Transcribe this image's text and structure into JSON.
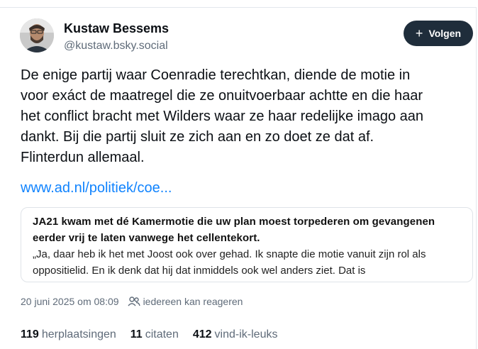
{
  "author": {
    "display_name": "Kustaw Bessems",
    "handle": "@kustaw.bsky.social"
  },
  "follow_button": {
    "label": "Volgen",
    "icon": "plus-icon"
  },
  "post": {
    "text": "De enige partij waar Coenradie terechtkan, diende de motie in\nvoor exáct de maatregel die ze onuitvoerbaar achtte en die haar\nhet conflict bracht met Wilders waar ze haar redelijke imago aan\ndankt. Bij die partij sluit ze zich aan en zo doet ze dat af.\nFlinterdun allemaal.",
    "link_text": "www.ad.nl/politiek/coe..."
  },
  "link_card": {
    "title": "JA21 kwam met dé Kamermotie die uw plan moest torpederen om gevangenen eerder vrij te laten vanwege het cellentekort.",
    "description": "„Ja, daar heb ik het met Joost ook over gehad. Ik snapte die motie vanuit zijn rol als oppositielid. En ik denk dat hij dat inmiddels ook wel anders ziet. Dat is"
  },
  "meta": {
    "timestamp": "20 juni 2025 om 08:09",
    "reply_setting": "iedereen kan reageren",
    "reply_icon": "people-icon"
  },
  "stats": {
    "reposts_count": "119",
    "reposts_label": "herplaatsingen",
    "quotes_count": "11",
    "quotes_label": "citaten",
    "likes_count": "412",
    "likes_label": "vind-ik-leuks"
  },
  "colors": {
    "link": "#1083fe",
    "button_bg": "#1f2d3b",
    "muted_text": "#5f6b79"
  }
}
